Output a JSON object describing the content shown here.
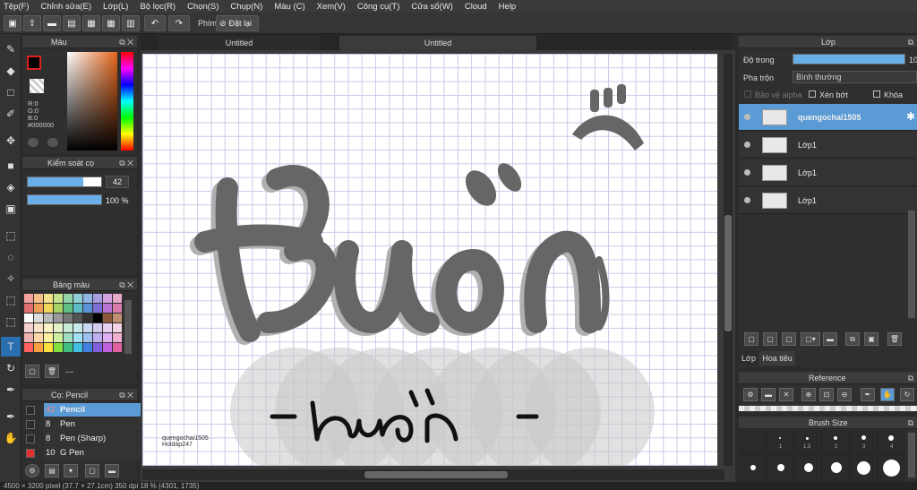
{
  "menu": [
    "Tệp(F)",
    "Chỉnh sửa(E)",
    "Lớp(L)",
    "Bộ lọc(R)",
    "Chọn(S)",
    "Chụp(N)",
    "Màu (C)",
    "Xem(V)",
    "Công cụ(T)",
    "Cửa sổ(W)",
    "Cloud",
    "Help"
  ],
  "toolbar": {
    "shortcut_label": "Phím",
    "reset_label": "Đặt lại"
  },
  "color_panel": {
    "title": "Màu",
    "r": "R:0",
    "g": "G:0",
    "b": "B:0",
    "hex": "#000000",
    "fg_color": "#000000"
  },
  "brush_control": {
    "title": "Kiểm soát cọ",
    "size": "42",
    "opacity": "100 %",
    "size_fraction": 0.75,
    "opacity_fraction": 1.0
  },
  "palette": {
    "title": "Bảng màu",
    "footer": "---",
    "colors": [
      "#f2a0a0",
      "#f6c08a",
      "#f7e38e",
      "#c6e28c",
      "#92d3a8",
      "#8fd0d6",
      "#90b6e4",
      "#a99de0",
      "#d2a2e0",
      "#e5a8c8",
      "#e26f6f",
      "#ef9f57",
      "#f1d65a",
      "#a7d162",
      "#5fbf84",
      "#5cbcc6",
      "#5c92d6",
      "#7f6fd2",
      "#b975d4",
      "#d97cab",
      "#ffffff",
      "#dddddd",
      "#bbbbbb",
      "#999999",
      "#777777",
      "#555555",
      "#333333",
      "#000000",
      "#8a5a3a",
      "#c09070",
      "#f4d0d0",
      "#f9e2c8",
      "#faf3c8",
      "#e4f1c6",
      "#c8e9d4",
      "#c7e7eb",
      "#c8daf2",
      "#d4cdf0",
      "#e8d0f0",
      "#f2d3e3",
      "#f0b0b0",
      "#ffd8a8",
      "#fff0a0",
      "#d0f0a0",
      "#a0e0c0",
      "#a0e0f0",
      "#a0c0f0",
      "#c0b0f0",
      "#e0b0f0",
      "#f0b0d0",
      "#ff6060",
      "#ffa040",
      "#ffe040",
      "#80e040",
      "#40c080",
      "#40c0e0",
      "#4080e0",
      "#8060e0",
      "#c060e0",
      "#e060a0"
    ]
  },
  "brushes": {
    "title": "Cọ: Pencil",
    "items": [
      {
        "size": "42",
        "name": "Pencil",
        "color": "#2a2a2a"
      },
      {
        "size": "8",
        "name": "Pen",
        "color": "#2a2a2a"
      },
      {
        "size": "8",
        "name": "Pen (Sharp)",
        "color": "#2a2a2a"
      },
      {
        "size": "10",
        "name": "G Pen",
        "color": "#e03030"
      }
    ]
  },
  "canvas_tabs": [
    "Untitled",
    "Untitled"
  ],
  "canvas": {
    "watermark_line1": "quengochai1505",
    "watermark_line2": "Holdap247"
  },
  "layers_panel": {
    "title": "Lớp",
    "opacity_label": "Độ trong",
    "opacity_value": "10",
    "opacity_fraction": 1.0,
    "blend_label": "Pha trộn",
    "blend_value": "Bình thường",
    "protect_alpha": "Bảo vệ alpha",
    "clipping": "Xén bớt",
    "lock": "Khóa",
    "layers": [
      {
        "name": "quengochai1505",
        "selected": true
      },
      {
        "name": "Lớp1",
        "selected": false
      },
      {
        "name": "Lớp1",
        "selected": false
      },
      {
        "name": "Lớp1",
        "selected": false
      }
    ],
    "tab_layers": "Lớp",
    "tab_navigator": "Hoa tiêu"
  },
  "reference": {
    "title": "Reference"
  },
  "brush_size": {
    "title": "Brush Size",
    "labels": [
      ".",
      "1",
      "1.5",
      "2",
      "3",
      "4",
      "5"
    ]
  },
  "status": {
    "text": "4500 × 3200 pixel  (37.7 × 27.1cm)  350 dpi  18 %  (4301, 1735)"
  }
}
